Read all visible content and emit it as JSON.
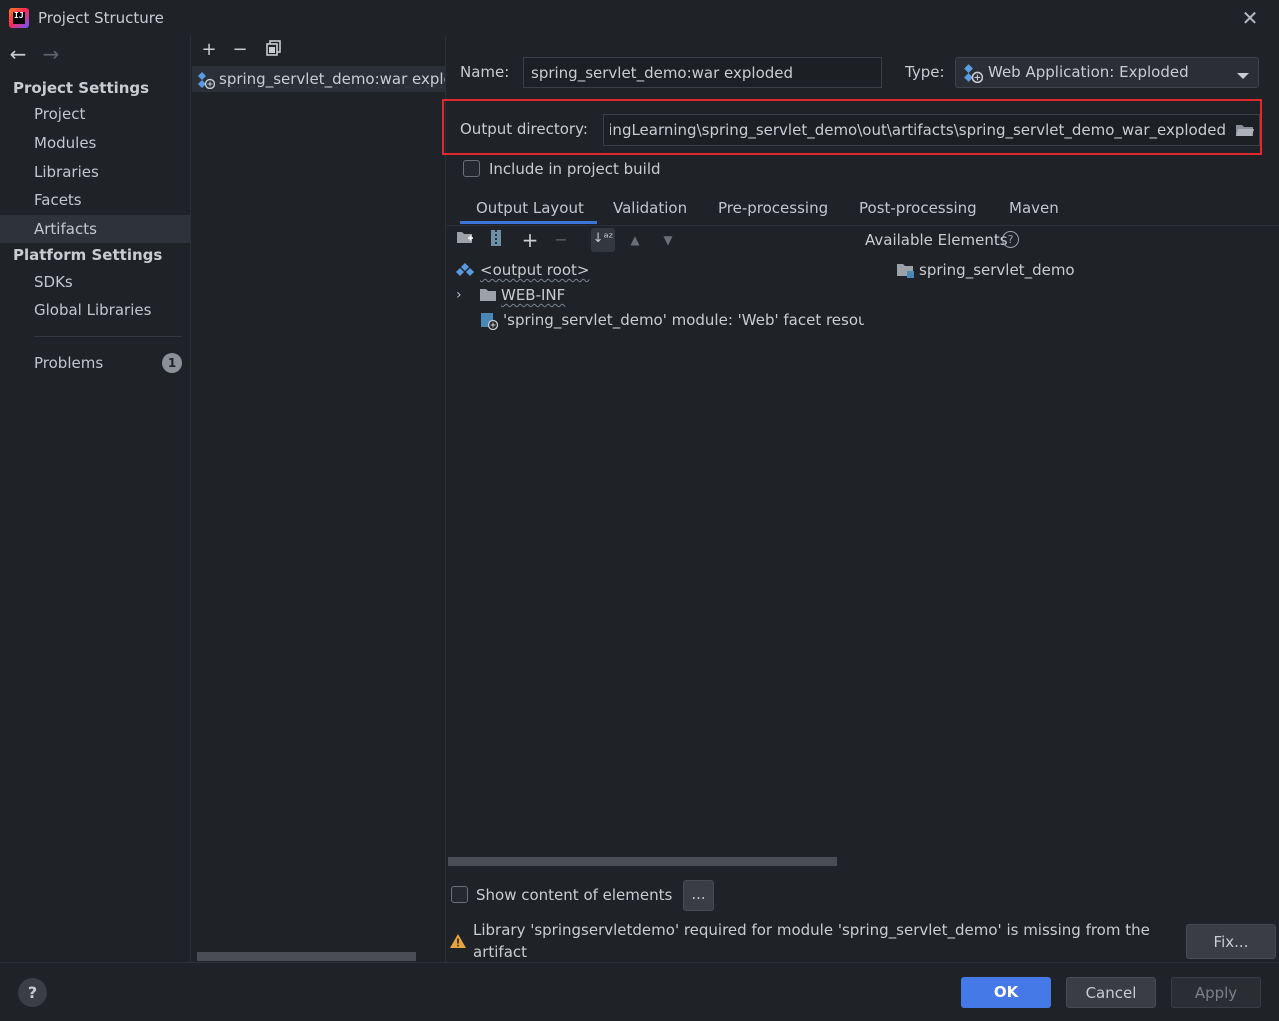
{
  "window": {
    "title": "Project Structure"
  },
  "nav": {
    "project_settings_header": "Project Settings",
    "project_settings_items": [
      "Project",
      "Modules",
      "Libraries",
      "Facets",
      "Artifacts"
    ],
    "selected_item": "Artifacts",
    "platform_settings_header": "Platform Settings",
    "platform_settings_items": [
      "SDKs",
      "Global Libraries"
    ],
    "problems_label": "Problems",
    "problems_count": "1"
  },
  "artifacts_list": {
    "items": [
      "spring_servlet_demo:war exploded"
    ]
  },
  "artifact": {
    "name_label": "Name:",
    "name_value": "spring_servlet_demo:war exploded",
    "type_label": "Type:",
    "type_value": "Web Application: Exploded",
    "output_dir_label": "Output directory:",
    "output_dir_value": "pringLearning\\spring_servlet_demo\\out\\artifacts\\spring_servlet_demo_war_exploded",
    "include_build_label": "Include in project build"
  },
  "tabs": [
    "Output Layout",
    "Validation",
    "Pre-processing",
    "Post-processing",
    "Maven"
  ],
  "active_tab": "Output Layout",
  "layout_tree": {
    "root": "<output root>",
    "folder": "WEB-INF",
    "module_resource": "'spring_servlet_demo' module: 'Web' facet resources"
  },
  "available_elements": {
    "title": "Available Elements",
    "items": [
      "spring_servlet_demo"
    ]
  },
  "bottom": {
    "show_content_label": "Show content of elements",
    "ellipsis_button": "...",
    "warning_line1": "Library 'springservletdemo' required for module 'spring_servlet_demo' is missing from the",
    "warning_line2": "artifact",
    "fix_button": "Fix..."
  },
  "footer": {
    "help": "?",
    "ok": "OK",
    "cancel": "Cancel",
    "apply": "Apply"
  },
  "colors": {
    "background": "#1f2227",
    "accent": "#4679e8",
    "highlight_border": "#e0282e",
    "warning": "#e8a33d"
  }
}
